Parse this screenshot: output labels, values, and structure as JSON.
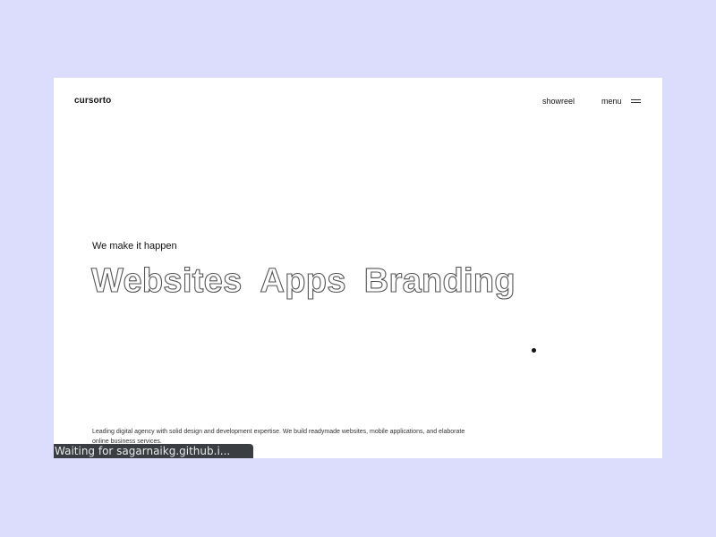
{
  "header": {
    "logo": "cursorto",
    "nav": {
      "showreel_label": "showreel",
      "menu_label": "menu"
    },
    "menu_icon": "hamburger-icon"
  },
  "hero": {
    "tagline": "We make it happen",
    "services": [
      "Websites",
      "Apps",
      "Branding"
    ],
    "description": "Leading digital agency with solid design and development expertise. We build readymade websites, mobile applications, and elaborate online business services."
  },
  "status_bar": {
    "text": "Waiting for sagarnaikg.github.i..."
  },
  "colors": {
    "background": "#dcdcfc",
    "page": "#ffffff",
    "text": "#111111",
    "outline_text_stroke": "#555555",
    "status_bar": "#3a3d42"
  }
}
